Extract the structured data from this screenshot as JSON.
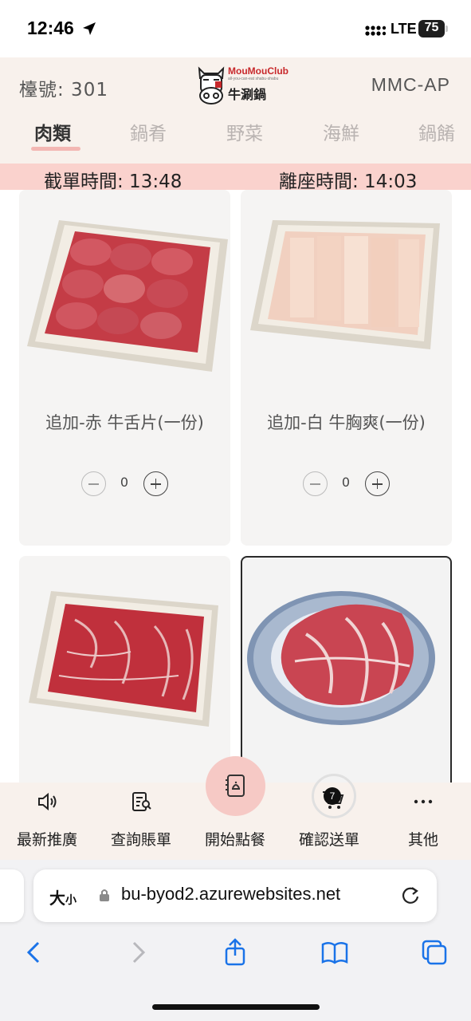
{
  "status_bar": {
    "time": "12:46",
    "network": "LTE",
    "battery": "75"
  },
  "header": {
    "table_label": "檯號: 301",
    "store_code": "MMC-AP",
    "logo": {
      "line1": "MouMouClub",
      "line2": "all-you-can-eat shabu-shabu",
      "line3": "牛涮鍋"
    }
  },
  "tabs": [
    {
      "label": "肉類",
      "active": true
    },
    {
      "label": "鍋肴",
      "active": false
    },
    {
      "label": "野菜",
      "active": false
    },
    {
      "label": "海鮮",
      "active": false
    },
    {
      "label": "鍋餚",
      "active": false
    }
  ],
  "banner": {
    "cutoff": "截單時間: 13:48",
    "leave": "離座時間: 14:03"
  },
  "products": [
    {
      "name": "追加-赤 牛舌片(一份)",
      "qty": "0"
    },
    {
      "name": "追加-白 牛胸爽(一份)",
      "qty": "0"
    },
    {
      "name": "",
      "qty": ""
    },
    {
      "name": "",
      "qty": ""
    }
  ],
  "bottom_nav": [
    {
      "label": "最新推廣",
      "icon": "speaker-icon"
    },
    {
      "label": "查詢賬單",
      "icon": "bill-search-icon"
    },
    {
      "label": "開始點餐",
      "icon": "order-book-icon"
    },
    {
      "label": "確認送單",
      "icon": "cart-icon"
    },
    {
      "label": "其他",
      "icon": "more-icon"
    }
  ],
  "cart": {
    "count": "7"
  },
  "safari": {
    "text_size": "大",
    "text_size_small": "小",
    "url": "bu-byod2.azurewebsites.net"
  },
  "colors": {
    "header_bg": "#f8f1ec",
    "banner_bg": "#fad2cd",
    "accent_pink": "#f6c9c5",
    "tab_underline": "#f3b7b3"
  }
}
